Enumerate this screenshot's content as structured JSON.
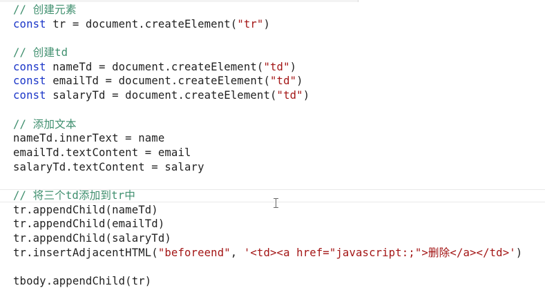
{
  "colors": {
    "background": "#ffffff",
    "comment": "#3f8f6e",
    "keyword": "#1a35c8",
    "string": "#a31515",
    "text": "#1f1f1f"
  },
  "code": {
    "comment_create_element": "// 创建元素",
    "l2_kw": "const",
    "l2_rest": " tr = document.createElement(",
    "l2_str": "\"tr\"",
    "l2_end": ")",
    "comment_create_td": "// 创建td",
    "l5_kw": "const",
    "l5_rest": " nameTd = document.createElement(",
    "l5_str": "\"td\"",
    "l5_end": ")",
    "l6_kw": "const",
    "l6_rest": " emailTd = document.createElement(",
    "l6_str": "\"td\"",
    "l6_end": ")",
    "l7_kw": "const",
    "l7_rest": " salaryTd = document.createElement(",
    "l7_str": "\"td\"",
    "l7_end": ")",
    "comment_add_text": "// 添加文本",
    "l10": "nameTd.innerText = name",
    "l11": "emailTd.textContent = email",
    "l12": "salaryTd.textContent = salary",
    "comment_append": "// 将三个td添加到tr中",
    "l15": "tr.appendChild(nameTd)",
    "l16": "tr.appendChild(emailTd)",
    "l17": "tr.appendChild(salaryTd)",
    "l18_a": "tr.insertAdjacentHTML(",
    "l18_s1": "\"beforeend\"",
    "l18_b": ", ",
    "l18_s2": "'<td><a href=\"javascript:;\">删除</a></td>'",
    "l18_c": ")",
    "l20": "tbody.appendChild(tr)"
  },
  "cursor": {
    "icon": "text-cursor-icon"
  }
}
